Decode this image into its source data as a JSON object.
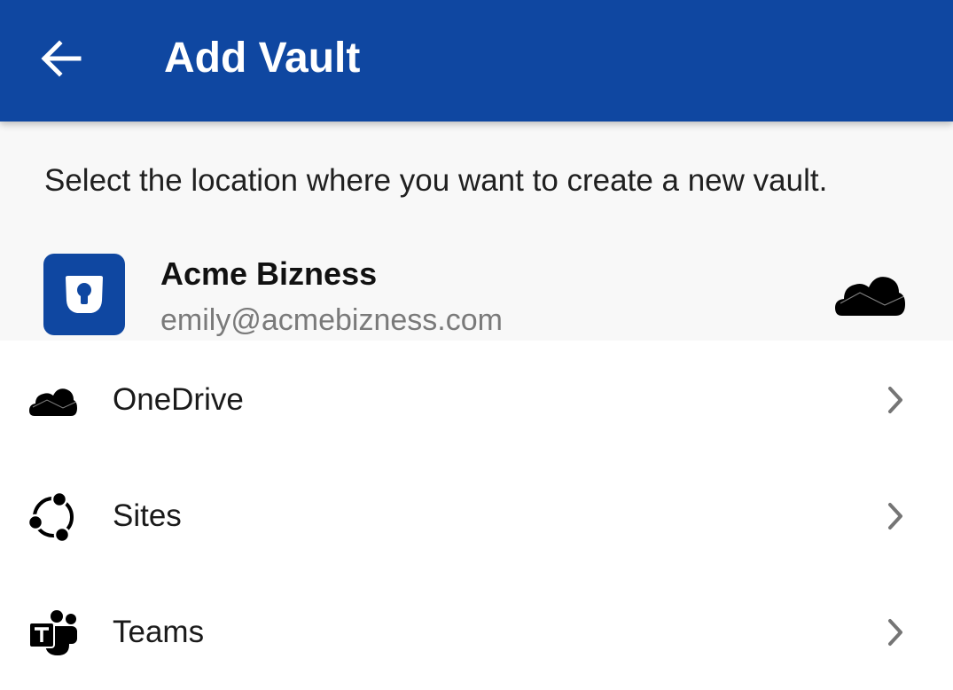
{
  "appbar": {
    "title": "Add Vault",
    "back_icon": "arrow-left-icon",
    "color": "#0f47a1"
  },
  "instruction": "Select the location where you want to create a new vault.",
  "account": {
    "name": "Acme Bizness",
    "email": "emily@acmebizness.com",
    "logo_icon": "keyhole-logo-icon",
    "cloud_icon": "onedrive-cloud-icon"
  },
  "locations": [
    {
      "label": "OneDrive",
      "icon": "onedrive-cloud-icon"
    },
    {
      "label": "Sites",
      "icon": "sharepoint-sites-icon"
    },
    {
      "label": "Teams",
      "icon": "teams-icon"
    }
  ],
  "colors": {
    "header_bg": "#f8f8f8",
    "chevron": "#757575",
    "email_text": "#7a7a7a"
  }
}
